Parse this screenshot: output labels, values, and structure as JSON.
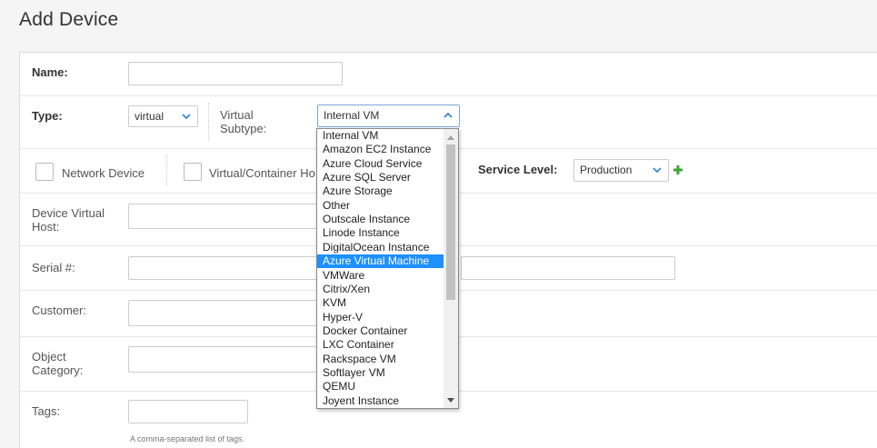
{
  "page": {
    "title": "Add Device"
  },
  "form": {
    "name_label": "Name:",
    "name_value": "",
    "type_label": "Type:",
    "type_value": "virtual",
    "subtype_label_line1": "Virtual",
    "subtype_label_line2": "Subtype:",
    "subtype_value": "Internal VM",
    "network_device_label": "Network Device",
    "virtual_container_label": "Virtual/Container Ho",
    "service_level_label": "Service Level:",
    "service_level_value": "Production",
    "device_virtual_host_label_line1": "Device Virtual",
    "device_virtual_host_label_line2": "Host:",
    "serial_label": "Serial #:",
    "customer_label": "Customer:",
    "object_category_label_line1": "Object",
    "object_category_label_line2": "Category:",
    "tags_label": "Tags:",
    "tags_help": "A comma-separated list of tags."
  },
  "dropdown": {
    "options": [
      "Internal VM",
      "Amazon EC2 Instance",
      "Azure Cloud Service",
      "Azure SQL Server",
      "Azure Storage",
      "Other",
      "Outscale Instance",
      "Linode Instance",
      "DigitalOcean Instance",
      "Azure Virtual Machine",
      "VMWare",
      "Citrix/Xen",
      "KVM",
      "Hyper-V",
      "Docker Container",
      "LXC Container",
      "Rackspace VM",
      "Softlayer VM",
      "QEMU",
      "Joyent Instance"
    ],
    "highlighted": "Azure Virtual Machine"
  },
  "colors": {
    "accent": "#1e90ff",
    "chevron": "#3a87d5",
    "plus": "#3aa832"
  },
  "icons": {
    "chevron": "chevron-down-icon",
    "chevron_up": "chevron-up-icon",
    "add": "plus-icon"
  }
}
